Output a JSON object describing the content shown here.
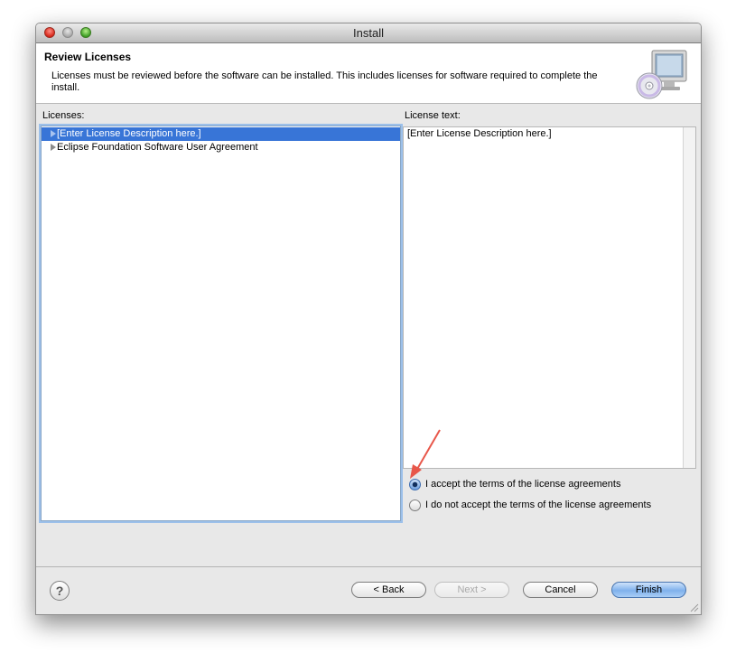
{
  "window": {
    "title": "Install"
  },
  "header": {
    "title": "Review Licenses",
    "description": "Licenses must be reviewed before the software can be installed.  This includes licenses for software required to complete the install.",
    "icon": "install-cd-monitor-icon"
  },
  "licenses": {
    "label": "Licenses:",
    "items": [
      {
        "label": "[Enter License Description here.]",
        "selected": true
      },
      {
        "label": "Eclipse Foundation Software User Agreement",
        "selected": false
      }
    ]
  },
  "license_text": {
    "label": "License text:",
    "content": "[Enter License Description here.]"
  },
  "agreement": {
    "accept_label": "I accept the terms of the license agreements",
    "decline_label": "I do not accept the terms of the license agreements",
    "selected": "accept"
  },
  "buttons": {
    "help": "?",
    "back": "< Back",
    "next": "Next >",
    "cancel": "Cancel",
    "finish": "Finish"
  },
  "colors": {
    "selection": "#3875d7",
    "focus_ring": "#9cc0ea",
    "annotation_arrow": "#e8574a"
  }
}
